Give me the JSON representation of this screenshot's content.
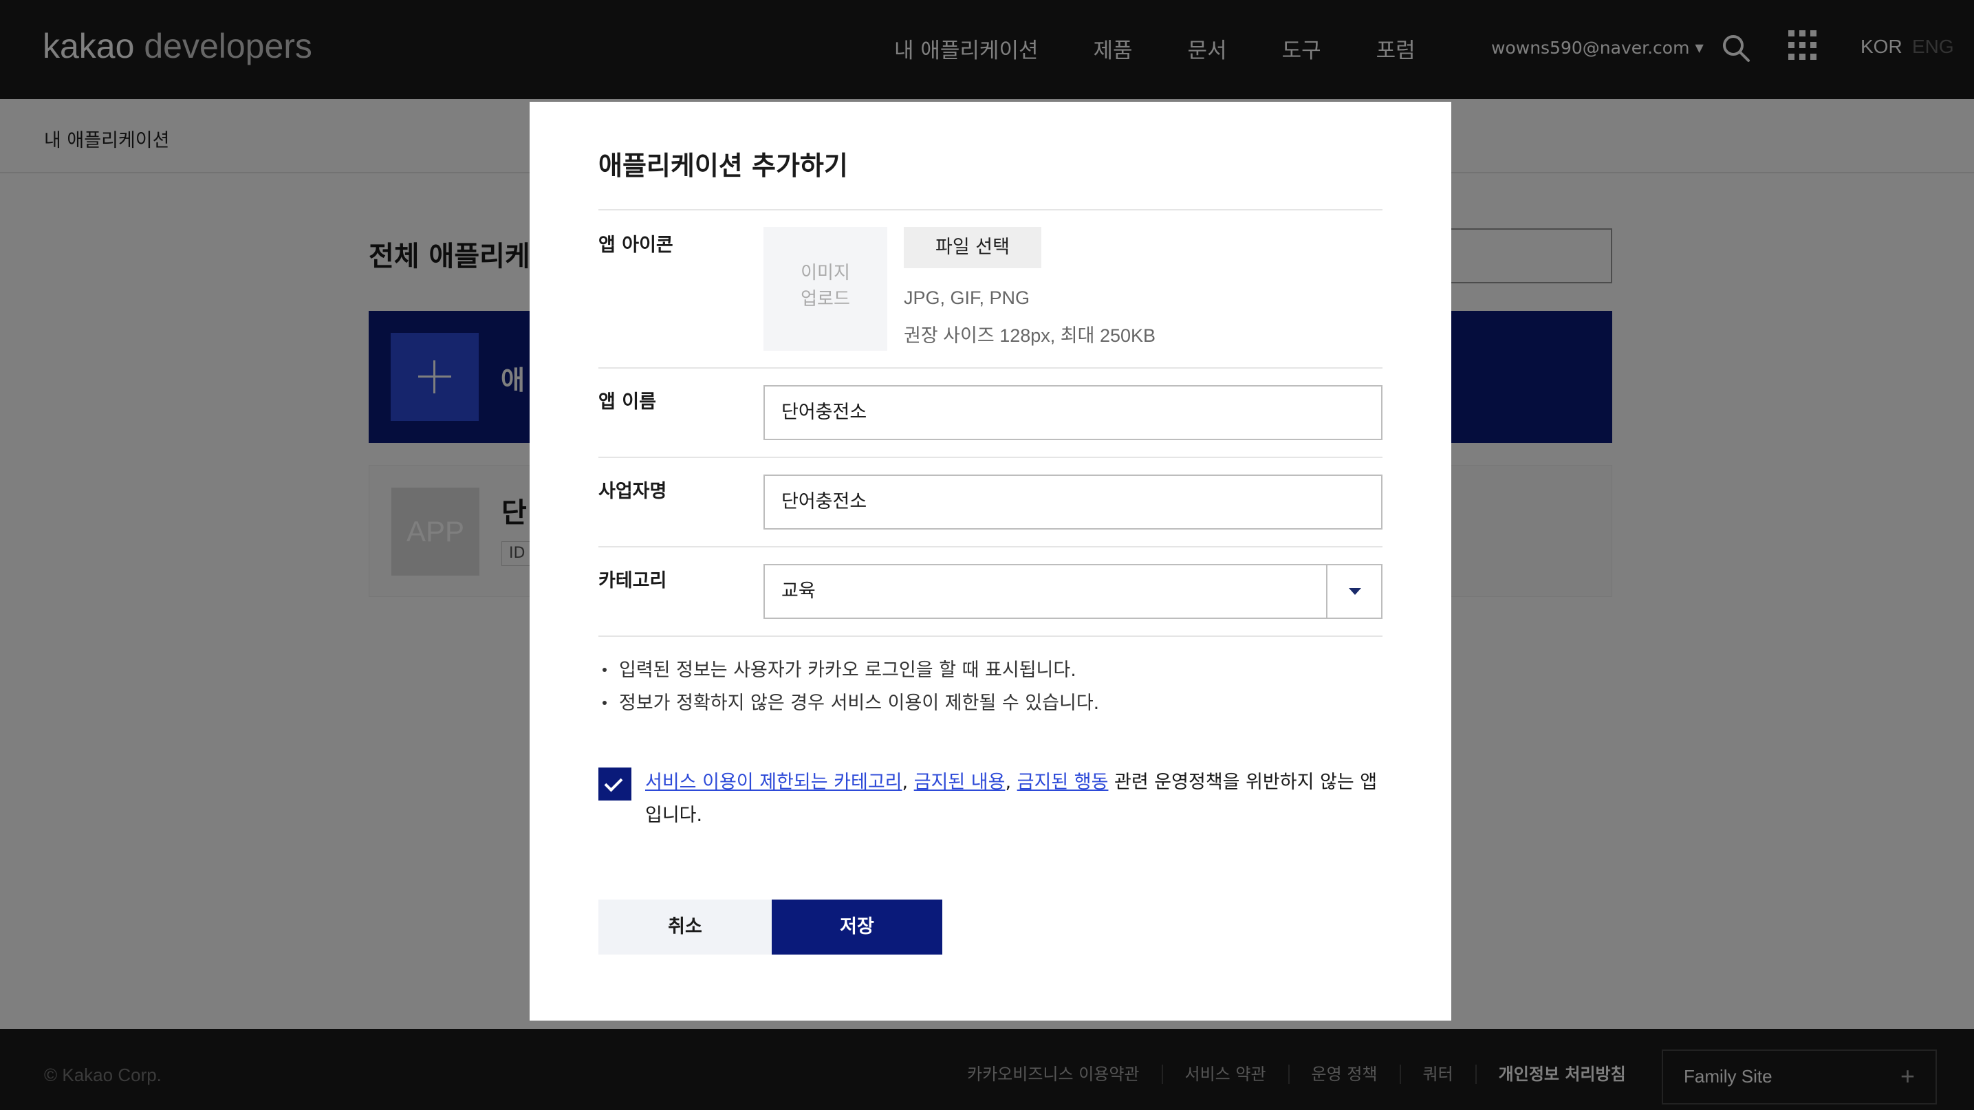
{
  "header": {
    "logo_kakao": "kakao",
    "logo_dev": " developers",
    "nav": [
      "내 애플리케이션",
      "제품",
      "문서",
      "도구",
      "포럼"
    ],
    "user_email": "wowns590@naver.com",
    "lang_kor": "KOR",
    "lang_eng": "ENG",
    "icons": {
      "search": "search-icon",
      "apps": "apps-grid-icon",
      "caret": "caret-down-icon"
    }
  },
  "subbar": {
    "breadcrumb": "내 애플리케이션"
  },
  "background": {
    "page_title": "전체 애플리케이",
    "add_card_label": "애",
    "app_thumb": "APP",
    "app_name": "단",
    "app_id_label": "ID"
  },
  "modal": {
    "title": "애플리케이션 추가하기",
    "icon_label": "앱 아이콘",
    "upload_line1": "이미지",
    "upload_line2": "업로드",
    "file_button": "파일 선택",
    "file_types": "JPG, GIF, PNG",
    "file_size_hint": "권장 사이즈 128px, 최대 250KB",
    "app_name_label": "앱 이름",
    "app_name_value": "단어충전소",
    "company_label": "사업자명",
    "company_value": "단어충전소",
    "category_label": "카테고리",
    "category_value": "교육",
    "notices": [
      "입력된 정보는 사용자가 카카오 로그인을 할 때 표시됩니다.",
      "정보가 정확하지 않은 경우 서비스 이용이 제한될 수 있습니다."
    ],
    "agree": {
      "checked": true,
      "link1": "서비스 이용이 제한되는 카테고리",
      "sep1": ", ",
      "link2": "금지된 내용",
      "sep2": ", ",
      "link3": "금지된 행동",
      "rest": " 관련 운영정책을 위반하지 않는 앱입니다."
    },
    "cancel_button": "취소",
    "save_button": "저장"
  },
  "footer": {
    "copyright": "© Kakao Corp.",
    "links": [
      "카카오비즈니스 이용약관",
      "서비스 약관",
      "운영 정책",
      "쿼터",
      "개인정보 처리방침"
    ],
    "family_site": "Family Site"
  },
  "colors": {
    "navy": "#0a1a7a",
    "link_blue": "#2d4ad8",
    "header_bg": "#1a1a1a"
  }
}
